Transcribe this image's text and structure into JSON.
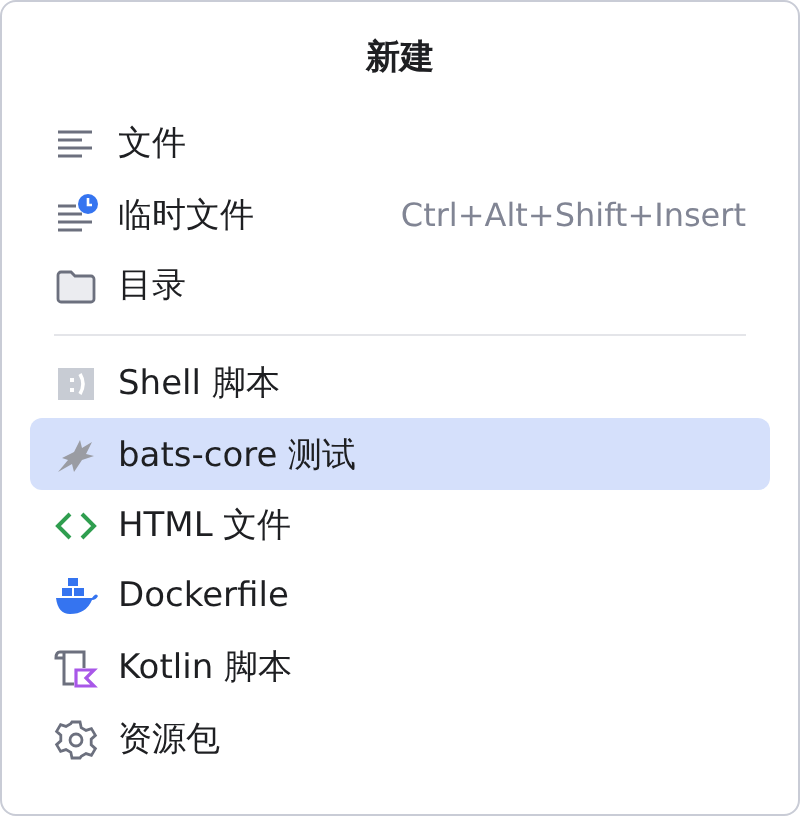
{
  "title": "新建",
  "groups": [
    {
      "items": [
        {
          "kind": "lines",
          "label": "文件",
          "selected": false
        },
        {
          "kind": "scratch",
          "label": "临时文件",
          "shortcut": "Ctrl+Alt+Shift+Insert",
          "selected": false
        },
        {
          "kind": "folder",
          "label": "目录",
          "selected": false
        }
      ]
    },
    {
      "items": [
        {
          "kind": "shell",
          "label": "Shell 脚本",
          "selected": false
        },
        {
          "kind": "bat",
          "label": "bats-core 测试",
          "selected": true
        },
        {
          "kind": "html",
          "label": "HTML 文件",
          "selected": false
        },
        {
          "kind": "docker",
          "label": "Dockerfile",
          "selected": false
        },
        {
          "kind": "kotlin",
          "label": "Kotlin 脚本",
          "selected": false
        },
        {
          "kind": "gear",
          "label": "资源包",
          "selected": false
        }
      ]
    }
  ]
}
